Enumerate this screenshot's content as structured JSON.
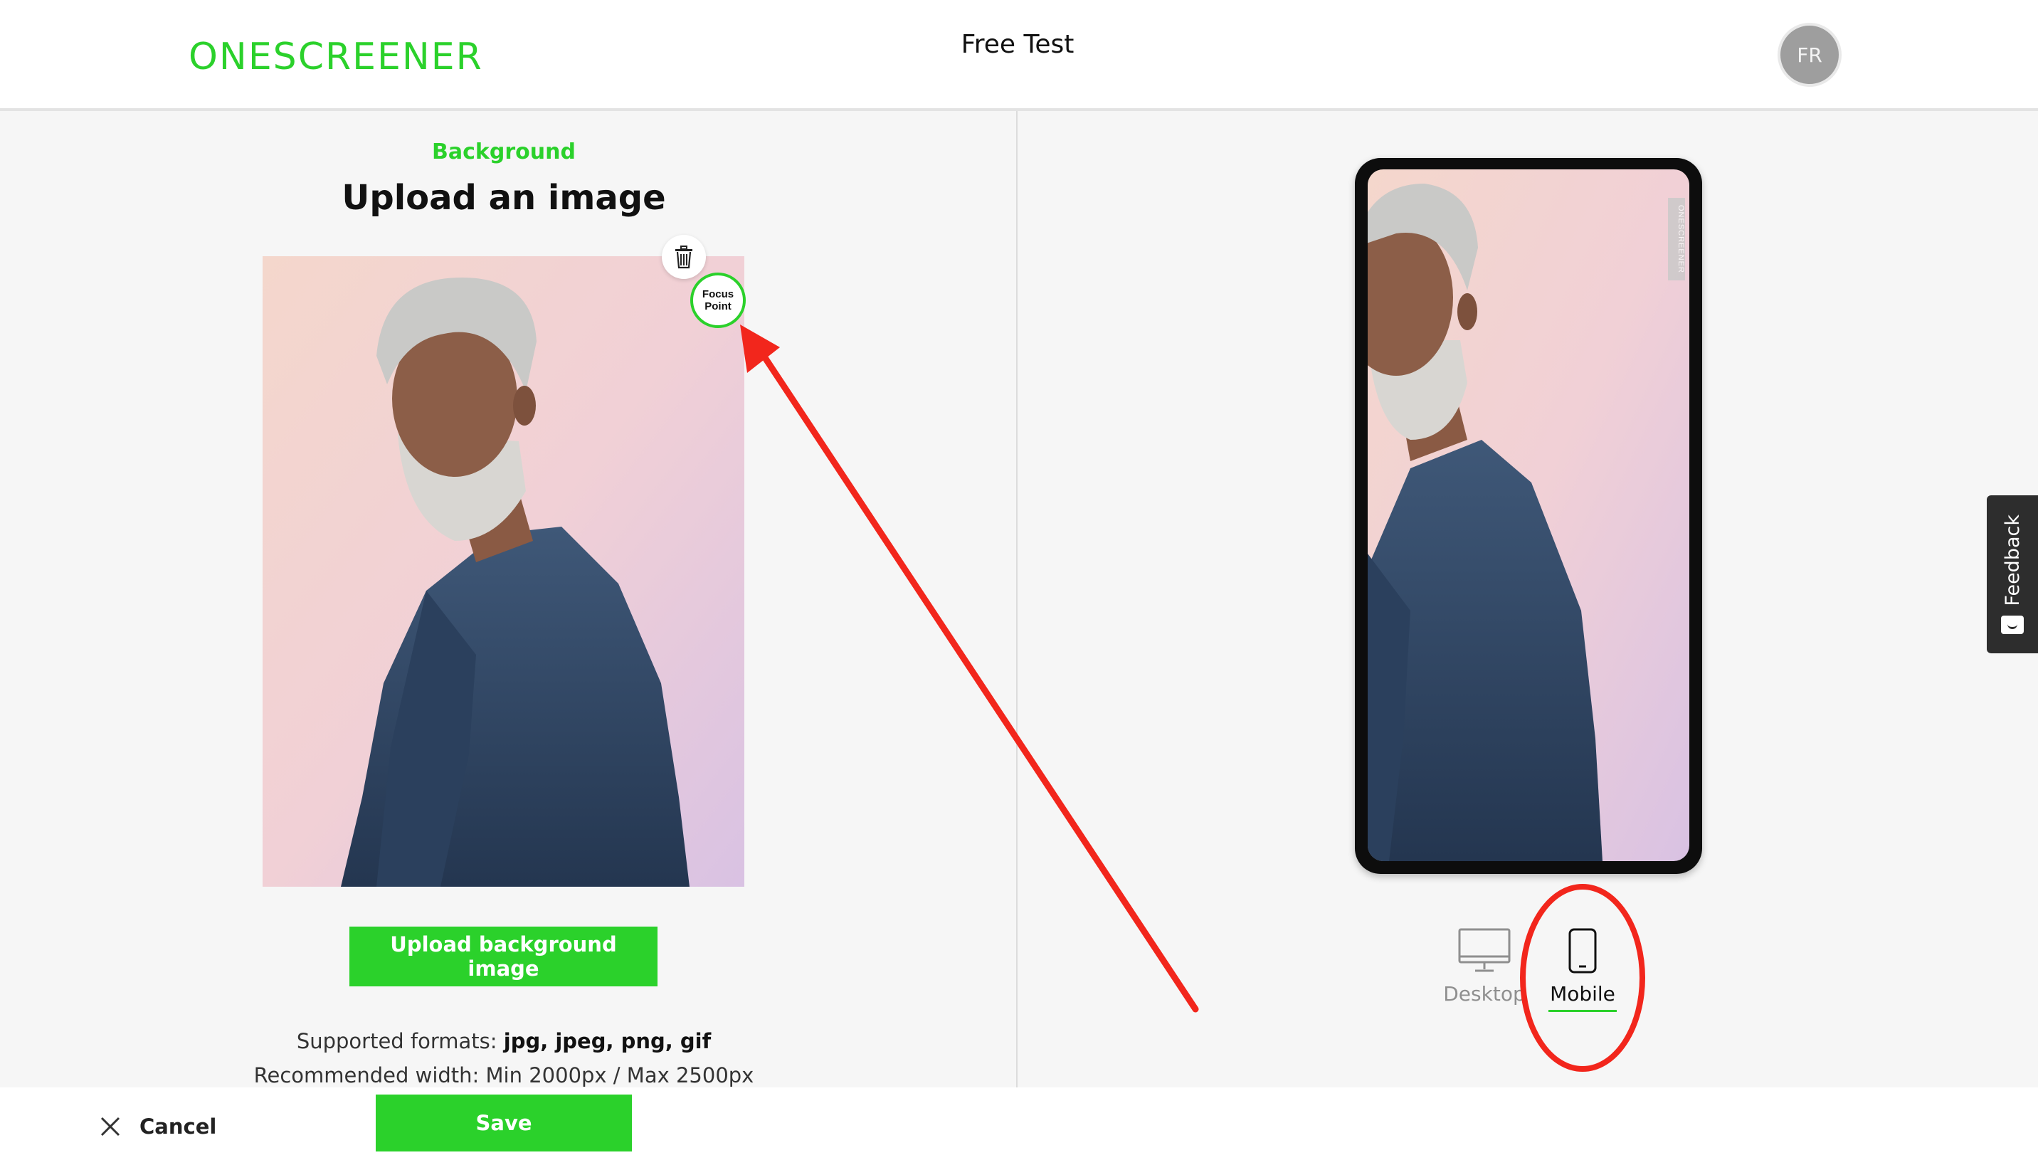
{
  "header": {
    "logo": "ONESCREENER",
    "title": "Free Test",
    "avatar_initials": "FR"
  },
  "editor": {
    "section_label": "Background",
    "section_title": "Upload an image",
    "focus_point_line1": "Focus",
    "focus_point_line2": "Point",
    "upload_button": "Upload background image",
    "formats_prefix": "Supported formats: ",
    "formats_values": "jpg, jpeg, png, gif",
    "recommended_width": "Recommended width: Min 2000px / Max 2500px"
  },
  "preview": {
    "watermark": "ONESCREENER",
    "devices": [
      {
        "label": "Desktop",
        "icon": "desktop-monitor-icon",
        "active": false
      },
      {
        "label": "Mobile",
        "icon": "mobile-phone-icon",
        "active": true
      }
    ]
  },
  "feedback": {
    "label": "Feedback"
  },
  "footer": {
    "cancel_label": "Cancel",
    "save_label": "Save"
  },
  "colors": {
    "brand_green": "#2bd12b",
    "annotation_red": "#f2261c",
    "background": "#f6f6f6"
  }
}
